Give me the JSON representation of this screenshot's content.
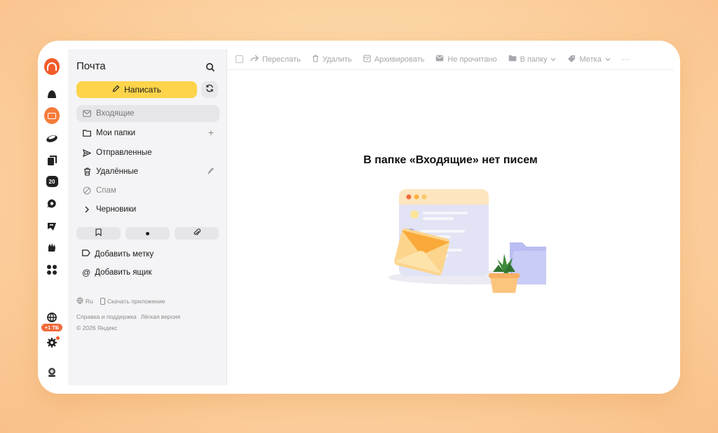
{
  "app": {
    "title": "Почта"
  },
  "rail": {
    "icons": [
      "yandex-logo-icon",
      "alice-icon",
      "mail-icon",
      "disk-icon",
      "documents-icon",
      "calendar-icon",
      "messenger-icon",
      "notes-icon",
      "telemost-icon",
      "services-icon",
      "globe-icon",
      "settings-icon",
      "profile-icon"
    ],
    "calendar_day": "20",
    "storage_badge": "+1 ТБ"
  },
  "sidebar": {
    "compose_label": "Написать",
    "folders": [
      {
        "label": "Входящие",
        "icon": "inbox-icon",
        "state": "active"
      },
      {
        "label": "Мои папки",
        "icon": "folder-icon",
        "action": "+"
      },
      {
        "label": "Отправленные",
        "icon": "send-icon"
      },
      {
        "label": "Удалённые",
        "icon": "trash-icon"
      },
      {
        "label": "Спам",
        "icon": "spam-icon",
        "state": "muted"
      },
      {
        "label": "Черновики",
        "icon": "chevron-right-icon"
      }
    ],
    "quick_filters": [
      "bookmark-icon",
      "unread-dot-icon",
      "attachment-icon"
    ],
    "actions": [
      {
        "label": "Добавить метку",
        "icon": "label-icon"
      },
      {
        "label": "Добавить ящик",
        "icon": "at-icon"
      }
    ],
    "footer": {
      "language": "Ru",
      "download_app": "Скачать приложение",
      "help": "Справка и поддержка",
      "lite": "Лёгкая версия",
      "copyright": "© 2026 Яндекс"
    }
  },
  "toolbar": {
    "forward": "Переслать",
    "delete": "Удалить",
    "archive": "Архивировать",
    "unread": "Не прочитано",
    "to_folder": "В папку",
    "label": "Метка",
    "more": "···"
  },
  "empty_state": {
    "title": "В папке «Входящие» нет писем"
  },
  "colors": {
    "accent": "#fdd44a",
    "brand": "#f25b2a",
    "background": "#fcd3a2"
  }
}
